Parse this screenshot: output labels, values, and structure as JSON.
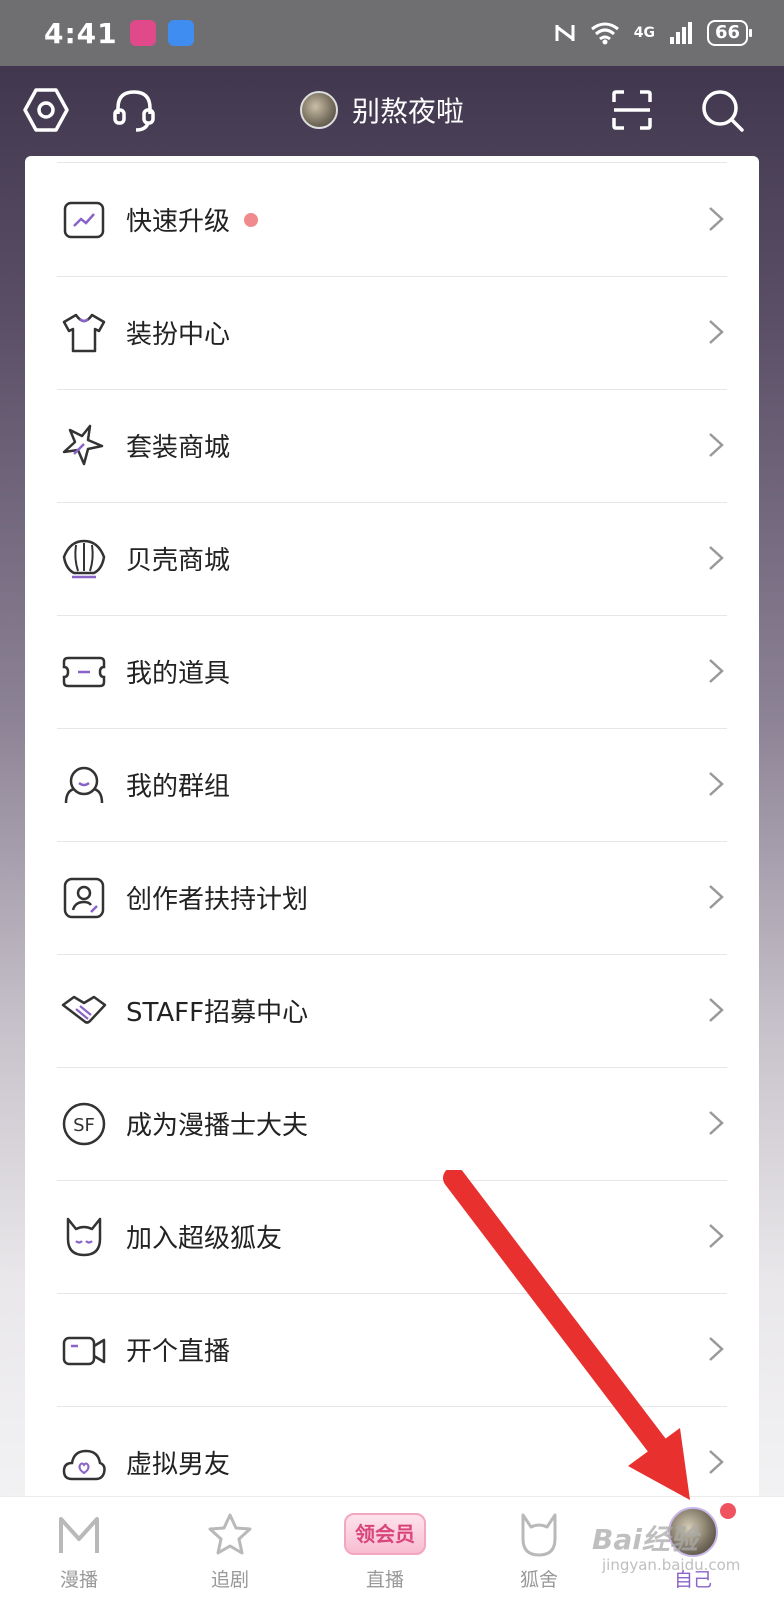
{
  "status_bar": {
    "time": "4:41",
    "network": "4G",
    "battery": "66"
  },
  "top_nav": {
    "username": "别熬夜啦",
    "icons": [
      "settings-hexagon-icon",
      "headset-icon",
      "scan-icon",
      "search-icon"
    ]
  },
  "menu": {
    "items": [
      {
        "label": "快速升级",
        "icon": "trend-up-icon",
        "badge": true
      },
      {
        "label": "装扮中心",
        "icon": "tshirt-icon"
      },
      {
        "label": "套装商城",
        "icon": "star-icon"
      },
      {
        "label": "贝壳商城",
        "icon": "shell-icon"
      },
      {
        "label": "我的道具",
        "icon": "ticket-icon"
      },
      {
        "label": "我的群组",
        "icon": "group-icon"
      },
      {
        "label": "创作者扶持计划",
        "icon": "creator-icon"
      },
      {
        "label": "STAFF招募中心",
        "icon": "handshake-icon"
      },
      {
        "label": "成为漫播士大夫",
        "icon": "sf-icon"
      },
      {
        "label": "加入超级狐友",
        "icon": "fox-icon"
      },
      {
        "label": "开个直播",
        "icon": "camera-icon"
      },
      {
        "label": "虚拟男友",
        "icon": "cloud-heart-icon"
      }
    ]
  },
  "tab_bar": {
    "tabs": [
      {
        "label": "漫播",
        "icon": "m-logo-icon"
      },
      {
        "label": "追剧",
        "icon": "star-outline-icon"
      },
      {
        "label": "直播",
        "icon": "vip-badge-icon",
        "badge_text": "领会员"
      },
      {
        "label": "狐舍",
        "icon": "fox-outline-icon"
      },
      {
        "label": "自己",
        "icon": "avatar-icon",
        "active": true
      }
    ]
  },
  "watermark": {
    "text": "Bai经验",
    "sub": "jingyan.baidu.com"
  },
  "colors": {
    "accent": "#8a63c9",
    "annotation_arrow": "#e8302f",
    "badge": "#f08a8d"
  }
}
